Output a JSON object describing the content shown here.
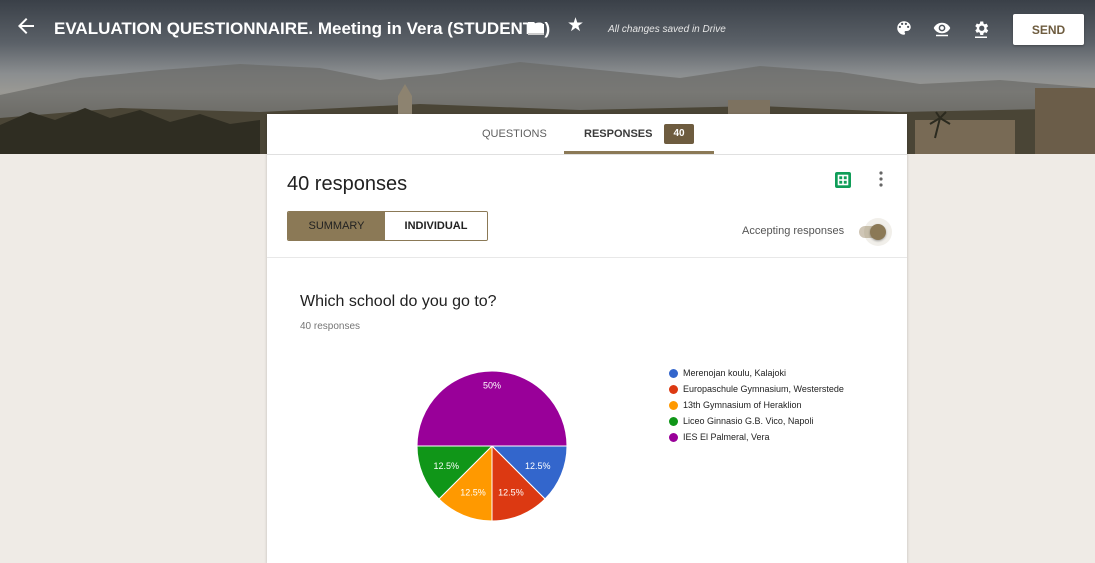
{
  "header": {
    "title": "EVALUATION QUESTIONNAIRE. Meeting in Vera (STUDENTS)",
    "save_status": "All changes saved in Drive",
    "send_label": "SEND"
  },
  "tabs": {
    "questions_label": "QUESTIONS",
    "responses_label": "RESPONSES",
    "responses_count": "40"
  },
  "summary": {
    "title": "40 responses",
    "summary_label": "SUMMARY",
    "individual_label": "INDIVIDUAL",
    "accepting_label": "Accepting responses",
    "accepting": true
  },
  "question": {
    "title": "Which school do you go to?",
    "count_label": "40 responses"
  },
  "colors": {
    "accent": "#8b7956",
    "badge": "#6e5c3f"
  },
  "chart_data": {
    "type": "pie",
    "categories": [
      "Merenojan koulu, Kalajoki",
      "Europaschule Gymnasium, Westerstede",
      "13th Gymnasium of Heraklion",
      "Liceo Ginnasio G.B. Vico, Napoli",
      "IES El Palmeral, Vera"
    ],
    "values": [
      12.5,
      12.5,
      12.5,
      12.5,
      50
    ],
    "labels": [
      "12.5%",
      "12.5%",
      "12.5%",
      "12.5%",
      "50%"
    ],
    "colors": [
      "#3366cc",
      "#dc3912",
      "#ff9900",
      "#109618",
      "#990099"
    ]
  }
}
